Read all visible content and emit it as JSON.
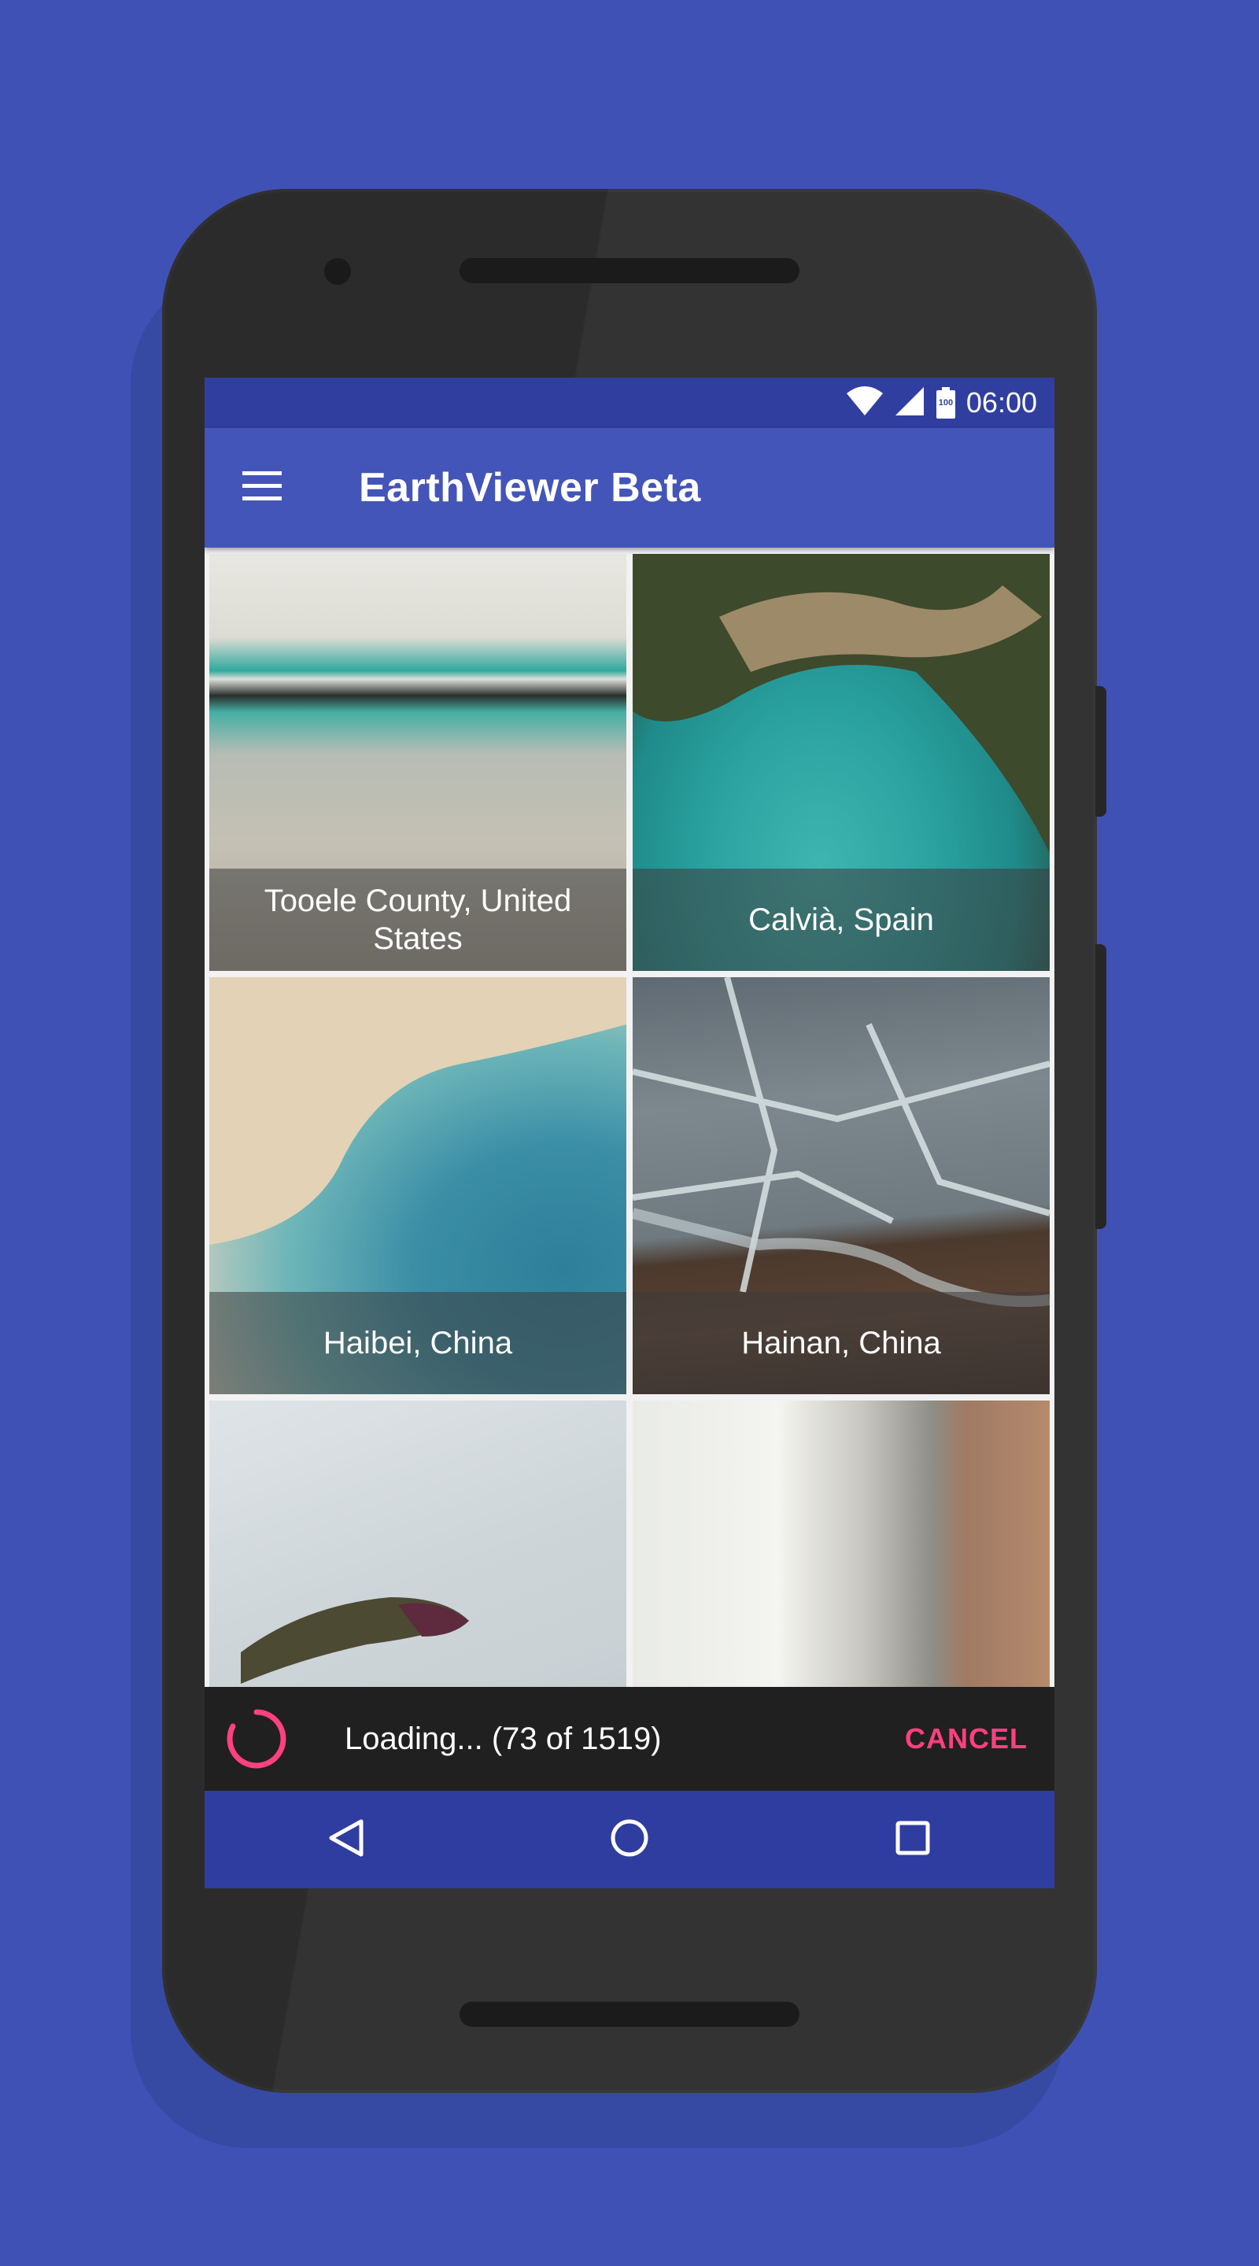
{
  "status_bar": {
    "time": "06:00",
    "battery_level": "100"
  },
  "app_bar": {
    "title": "EarthViewer Beta",
    "menu_icon": "hamburger-menu-icon"
  },
  "gallery": {
    "tiles": [
      {
        "caption": "Tooele County, United States"
      },
      {
        "caption": "Calvià, Spain"
      },
      {
        "caption": "Haibei, China"
      },
      {
        "caption": "Hainan, China"
      },
      {
        "caption": ""
      },
      {
        "caption": ""
      }
    ]
  },
  "snackbar": {
    "message": "Loading... (73 of 1519)",
    "action": "CANCEL",
    "progress_icon": "spinner-icon"
  },
  "nav_bar": {
    "back": "back-icon",
    "home": "home-icon",
    "recents": "recents-icon"
  },
  "colors": {
    "background": "#3f51b5",
    "status_bar": "#303f9f",
    "app_bar": "#4355b9",
    "accent": "#ff4081",
    "snackbar": "#202020"
  }
}
